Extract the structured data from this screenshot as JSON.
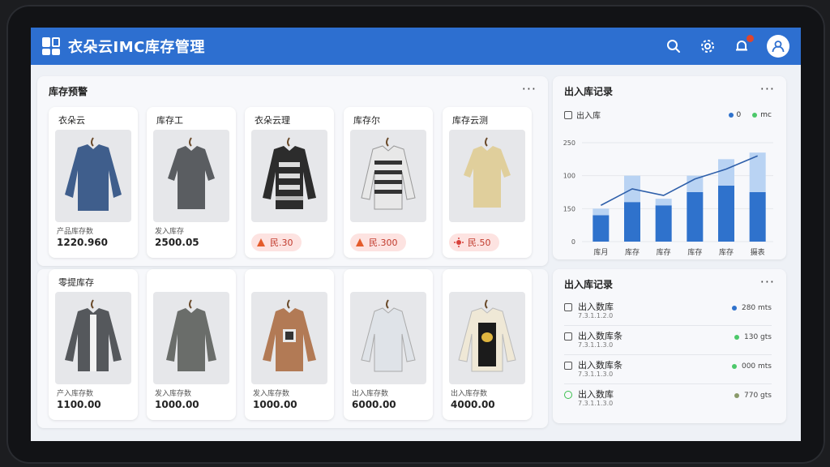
{
  "header": {
    "title": "衣朵云IMC库存管理"
  },
  "warning_panel": {
    "title": "库存预警",
    "items": [
      {
        "name": "衣朵云",
        "sub": "产品库存数",
        "value": "1220.960"
      },
      {
        "name": "库存工",
        "sub": "发入库存",
        "value": "2500.05"
      },
      {
        "name": "衣朵云理",
        "alert": "民.30"
      },
      {
        "name": "库存尔",
        "alert": "民.300"
      },
      {
        "name": "库存云测",
        "alert": "民.50"
      }
    ]
  },
  "other_panel": {
    "title": "零提库存",
    "items": [
      {
        "sub": "产入库存数",
        "value": "1100.00"
      },
      {
        "sub": "发入库存数",
        "value": "1000.00"
      },
      {
        "sub": "发入库存数",
        "value": "1000.00"
      },
      {
        "sub": "出入库存数",
        "value": "6000.00"
      },
      {
        "sub": "出入库存数",
        "value": "4000.00"
      }
    ]
  },
  "chart_panel": {
    "title": "出入库记录",
    "legend_label": "出入库",
    "legend_a": "0",
    "legend_b": "mc",
    "colors": {
      "bar_dark": "#2f72cc",
      "bar_light": "#b9d3f3",
      "line": "#2e5faa"
    }
  },
  "chart_data": {
    "type": "bar",
    "categories": [
      "库月",
      "库存",
      "库存",
      "库存",
      "库存",
      "摄表"
    ],
    "series": [
      {
        "values": [
          80,
          120,
          110,
          150,
          170,
          150
        ]
      },
      {
        "values": [
          20,
          80,
          20,
          50,
          80,
          120
        ]
      }
    ],
    "line": [
      110,
      160,
      140,
      190,
      220,
      260
    ],
    "ylim": [
      0,
      300
    ],
    "ytick_labels": [
      "0",
      "150",
      "100",
      "250"
    ]
  },
  "records_panel": {
    "title": "出入库记录",
    "rows": [
      {
        "title": "出入数库",
        "sub": "7.3.1.1.2.0",
        "value": "280 mts",
        "color": "#2f72cc"
      },
      {
        "title": "出入数库条",
        "sub": "7.3.1.1.3.0",
        "value": "130 gts",
        "color": "#4cc86a"
      },
      {
        "title": "出入数库条",
        "sub": "7.3.1.1.3.0",
        "value": "000 mts",
        "color": "#4cc86a"
      },
      {
        "title": "出入数库",
        "sub": "7.3.1.1.3.0",
        "value": "770 gts",
        "color": "#8a9a6a"
      }
    ]
  }
}
